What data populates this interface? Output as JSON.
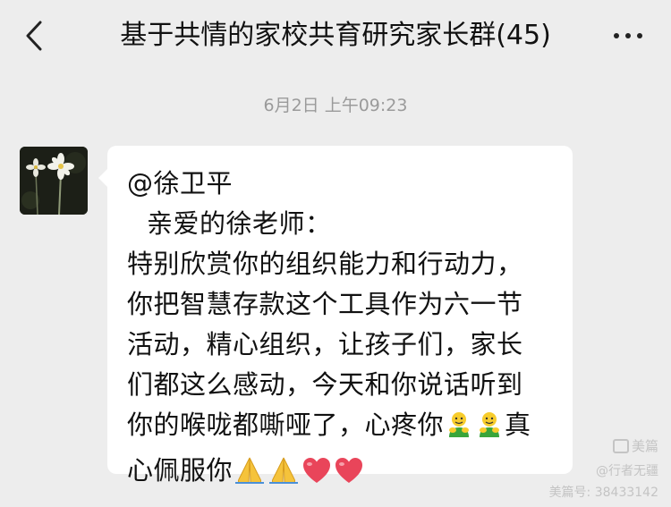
{
  "header": {
    "back_icon": "chevron-left-icon",
    "title": "基于共情的家校共育研究家长群(45)",
    "more_icon": "more-dots-icon"
  },
  "chat": {
    "timestamp": "6月2日 上午09:23",
    "message": {
      "avatar": "flower-photo-avatar",
      "mention": "@徐卫平",
      "greeting": "亲爱的徐老师：",
      "lines": [
        "特别欣赏你的组织能力和行动力，",
        "你把智慧存款这个工具作为六一节",
        "活动，精心组织，让孩子们，家长",
        "们都这么感动，今天和你说话听到"
      ],
      "line5_text": "你的喉咙都嘶哑了，心疼你",
      "line5_end": "真",
      "line6_text": "心佩服你",
      "emoji": {
        "hug": "hugging-person-emoji",
        "pray": "praying-hands-emoji",
        "heart": "red-heart-emoji"
      }
    }
  },
  "watermark": {
    "logo_text": "美篇",
    "author": "@行者无疆",
    "id_text": "美篇号: 38433142"
  },
  "colors": {
    "background": "#ededed",
    "bubble": "#ffffff",
    "timestamp": "#9a9a9a",
    "text": "#111111"
  }
}
